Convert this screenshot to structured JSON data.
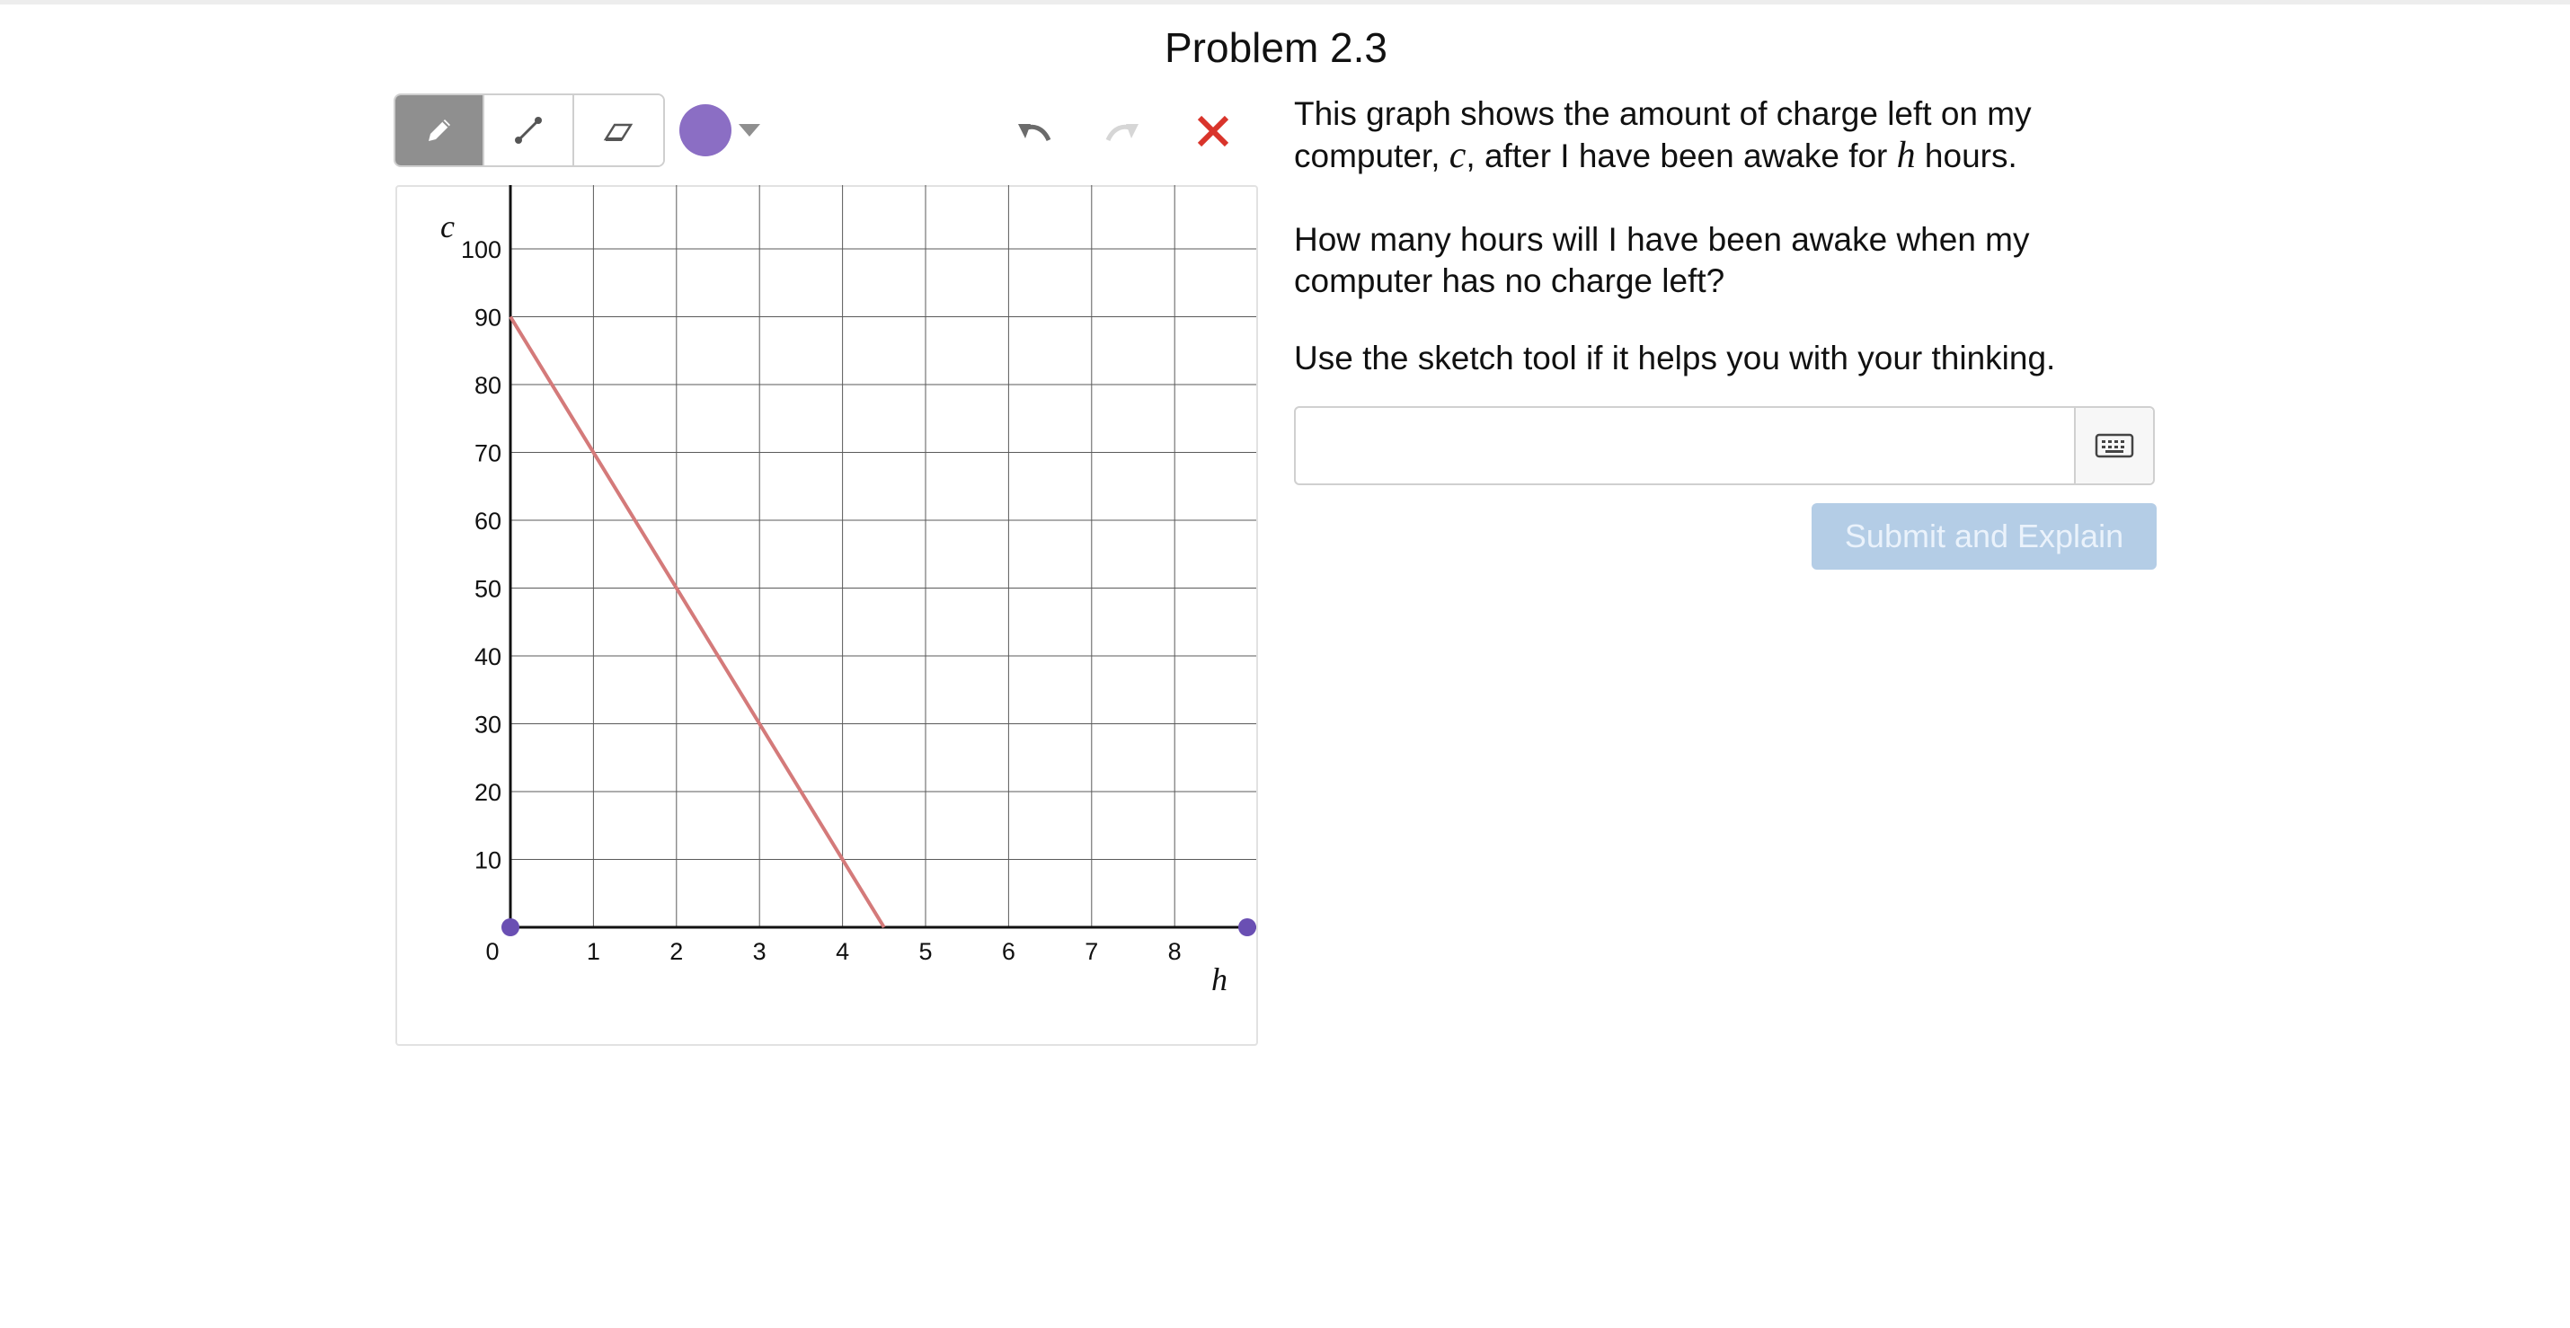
{
  "page": {
    "title": "Problem 2.3"
  },
  "toolbar": {
    "tools": [
      {
        "name": "pencil",
        "icon": "pencil-icon",
        "active": true
      },
      {
        "name": "line",
        "icon": "line-segment-icon",
        "active": false
      },
      {
        "name": "eraser",
        "icon": "eraser-icon",
        "active": false
      }
    ],
    "selected_color": "#8b6ec4",
    "undo_icon": "undo-icon",
    "redo_icon": "redo-icon",
    "clear_icon": "close-icon",
    "clear_color": "#d9342b"
  },
  "chart_data": {
    "type": "line",
    "xlabel": "h",
    "ylabel": "c",
    "xlim": [
      0,
      8.9
    ],
    "ylim": [
      0,
      100
    ],
    "x_ticks": [
      0,
      1,
      2,
      3,
      4,
      5,
      6,
      7,
      8
    ],
    "y_ticks": [
      10,
      20,
      30,
      40,
      50,
      60,
      70,
      80,
      90,
      100
    ],
    "grid": true,
    "series": [
      {
        "color": "#d47a7a",
        "x": [
          0,
          4.5
        ],
        "y": [
          90,
          0
        ]
      }
    ],
    "movable_points": [
      {
        "x": 0,
        "y": 0,
        "color": "#6a4fb3"
      },
      {
        "x": 8.9,
        "y": 0,
        "color": "#6a4fb3"
      }
    ]
  },
  "prompt": {
    "p1_a": "This graph shows the amount of charge left on my computer, ",
    "p1_var1": "c",
    "p1_b": ", after I have been awake for ",
    "p1_var2": "h",
    "p1_c": " hours.",
    "p2": "How many hours will I have been awake when my computer has no charge left?",
    "p3": "Use the sketch tool if it helps you with your thinking."
  },
  "answer": {
    "value": "",
    "placeholder": "",
    "keyboard_icon": "keyboard-icon"
  },
  "submit": {
    "label": "Submit and Explain"
  }
}
